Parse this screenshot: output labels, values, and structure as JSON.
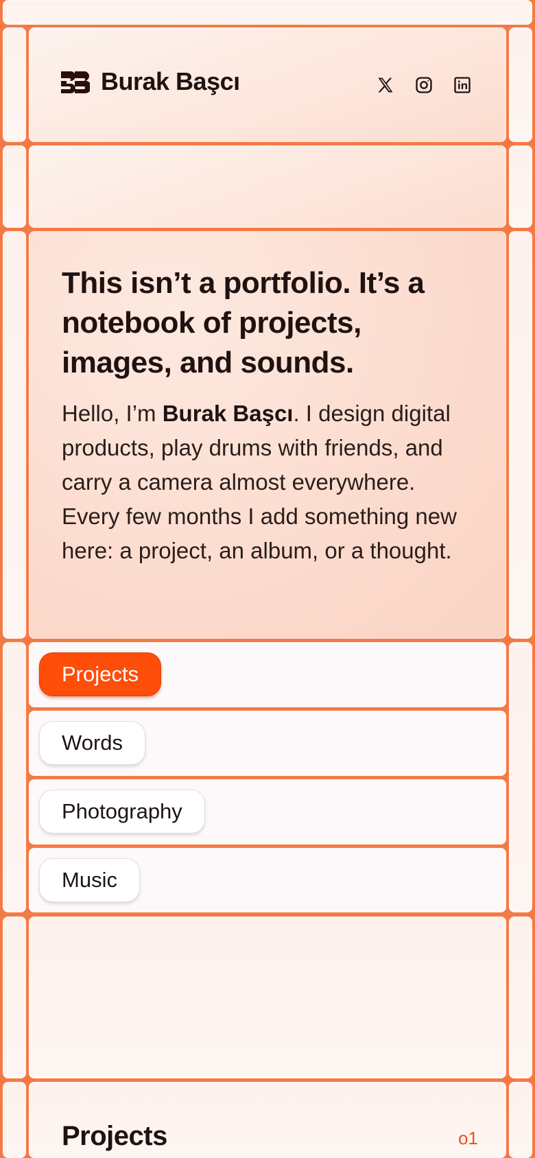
{
  "header": {
    "site_name": "Burak Başcı",
    "social": [
      {
        "name": "x-icon"
      },
      {
        "name": "instagram-icon"
      },
      {
        "name": "linkedin-icon"
      }
    ]
  },
  "hero": {
    "title": "This isn’t a portfolio. It’s a notebook of projects, images, and sounds.",
    "intro_prefix": "Hello, I’m ",
    "intro_name": "Burak Başcı",
    "intro_suffix": ". I design digital products, play drums with friends, and carry a camera almost everywhere. Every few months I add something new here: a project, an album, or a thought."
  },
  "nav": {
    "items": [
      {
        "label": "Projects",
        "active": true
      },
      {
        "label": "Words",
        "active": false
      },
      {
        "label": "Photography",
        "active": false
      },
      {
        "label": "Music",
        "active": false
      }
    ]
  },
  "section": {
    "title": "Projects",
    "count": "o1"
  },
  "colors": {
    "accent": "#ff4d0a",
    "grid_lines": "#f47a45",
    "text": "#1f1210"
  }
}
